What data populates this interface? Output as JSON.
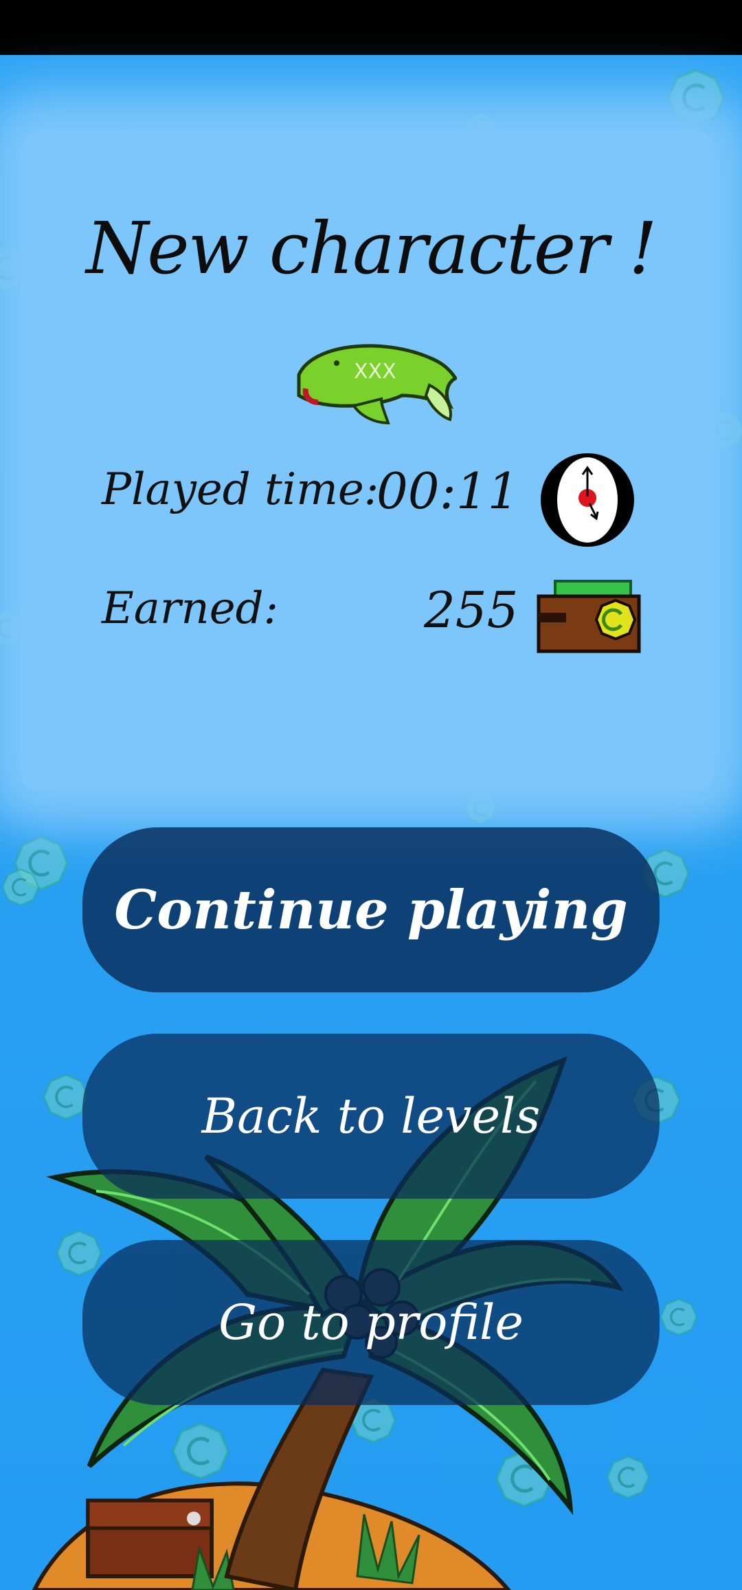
{
  "result_screen": {
    "title": "New character !",
    "played_time_label": "Played time:",
    "played_time_value": "00:11",
    "earned_label": "Earned:",
    "earned_value": "255"
  },
  "buttons": {
    "continue_label": "Continue playing",
    "levels_label": "Back to levels",
    "profile_label": "Go to profile"
  },
  "icons": {
    "character": "fish-character-icon",
    "timer": "clock-icon",
    "wallet": "wallet-icon",
    "coin_symbol": "C"
  },
  "colors": {
    "background": "#2ba2f3",
    "panel": "#7cc6fb",
    "button": "#0a3060",
    "coin": "#55c9c0"
  }
}
